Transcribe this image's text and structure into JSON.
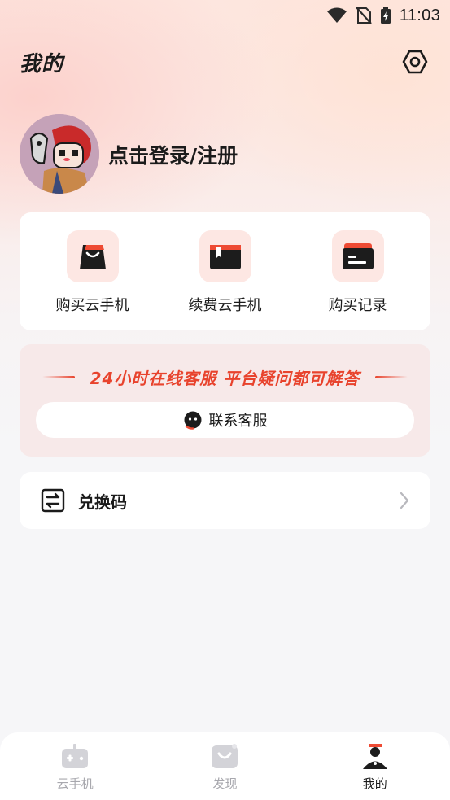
{
  "status_bar": {
    "time": "11:03",
    "icons": [
      "wifi-icon",
      "no-sim-icon",
      "battery-charging-icon"
    ]
  },
  "header": {
    "title": "我的",
    "settings_icon": "settings-icon"
  },
  "profile": {
    "login_text": "点击登录/注册"
  },
  "shortcuts": [
    {
      "label": "购买云手机",
      "icon": "shopping-bag-icon"
    },
    {
      "label": "续费云手机",
      "icon": "renew-box-icon"
    },
    {
      "label": "购买记录",
      "icon": "record-card-icon"
    }
  ],
  "service": {
    "slogan": "24小时在线客服 平台疑问都可解答",
    "button_label": "联系客服",
    "accent_color": "#e8432d"
  },
  "redeem": {
    "label": "兑换码"
  },
  "tabbar": {
    "tabs": [
      {
        "label": "云手机",
        "icon": "gamepad-icon",
        "active": false
      },
      {
        "label": "发现",
        "icon": "discover-icon",
        "active": false
      },
      {
        "label": "我的",
        "icon": "profile-icon",
        "active": true
      }
    ]
  },
  "colors": {
    "accent": "#f05a3a",
    "tab_inactive": "#a8a8ae",
    "icon_bg": "#fde7e3"
  }
}
